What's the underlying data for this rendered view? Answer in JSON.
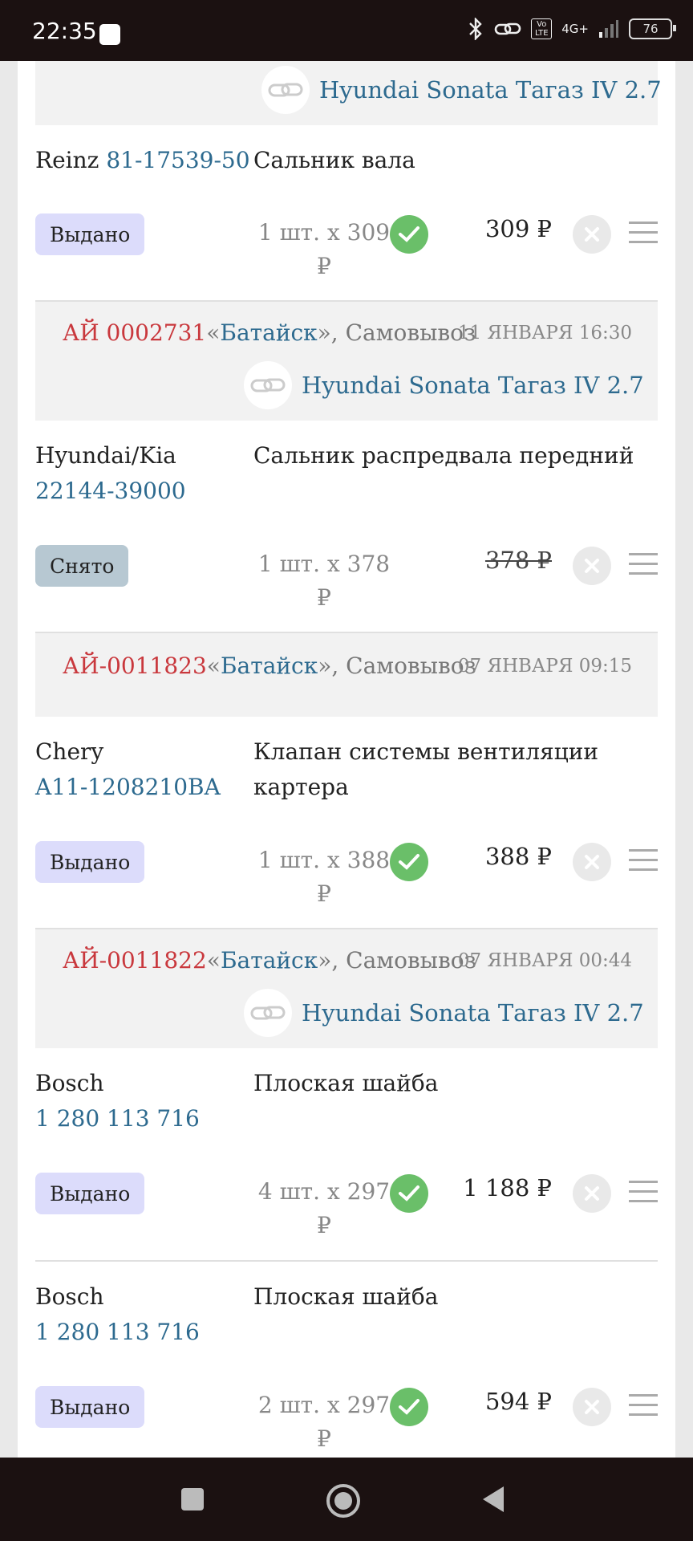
{
  "status_bar": {
    "time": "22:35",
    "network": "4G+",
    "volte": "Vo LTE",
    "battery": "76",
    "icons": [
      "bluetooth-icon",
      "link-icon",
      "volte-icon",
      "signal-icon",
      "battery-icon"
    ]
  },
  "orders": [
    {
      "car": "Hyundai Sonata Тагаз IV 2.7",
      "items": [
        {
          "brand": "Reinz",
          "article": "81-17539-50",
          "name": "Сальник вала",
          "status": "Выдано",
          "qty": "1 шт. x 309",
          "currency": "₽",
          "price": "309 ₽",
          "confirmed": true
        }
      ]
    },
    {
      "number": "АЙ 0002731",
      "open_quote": "«",
      "location": "Батайск",
      "close_quote": "», Самовывоз",
      "date": "11 ЯНВАРЯ 16:30",
      "car": "Hyundai Sonata Тагаз IV 2.7",
      "items": [
        {
          "brand": "Hyundai/Kia",
          "article": "22144-39000",
          "name": "Сальник распредвала передний",
          "status": "Снято",
          "qty": "1 шт. x 378",
          "currency": "₽",
          "price": "378 ₽",
          "confirmed": false
        }
      ]
    },
    {
      "number": "АЙ-0011823",
      "open_quote": "«",
      "location": "Батайск",
      "close_quote": "», Самовывоз",
      "date": "07 ЯНВАРЯ 09:15",
      "items": [
        {
          "brand": "Chery",
          "article": "A11-1208210BA",
          "name": "Клапан системы вентиляции картера",
          "status": "Выдано",
          "qty": "1 шт. x 388",
          "currency": "₽",
          "price": "388 ₽",
          "confirmed": true
        }
      ]
    },
    {
      "number": "АЙ-0011822",
      "open_quote": "«",
      "location": "Батайск",
      "close_quote": "», Самовывоз",
      "date": "07 ЯНВАРЯ 00:44",
      "car": "Hyundai Sonata Тагаз IV 2.7",
      "items": [
        {
          "brand": "Bosch",
          "article": "1 280 113 716",
          "name": "Плоская шайба",
          "status": "Выдано",
          "qty": "4 шт. x 297",
          "currency": "₽",
          "price": "1 188 ₽",
          "confirmed": true
        },
        {
          "brand": "Bosch",
          "article": "1 280 113 716",
          "name": "Плоская шайба",
          "status": "Выдано",
          "qty": "2 шт. x 297",
          "currency": "₽",
          "price": "594 ₽",
          "confirmed": true
        }
      ]
    }
  ],
  "nav": {
    "icons": [
      "recent-apps-icon",
      "home-icon",
      "back-icon"
    ]
  }
}
